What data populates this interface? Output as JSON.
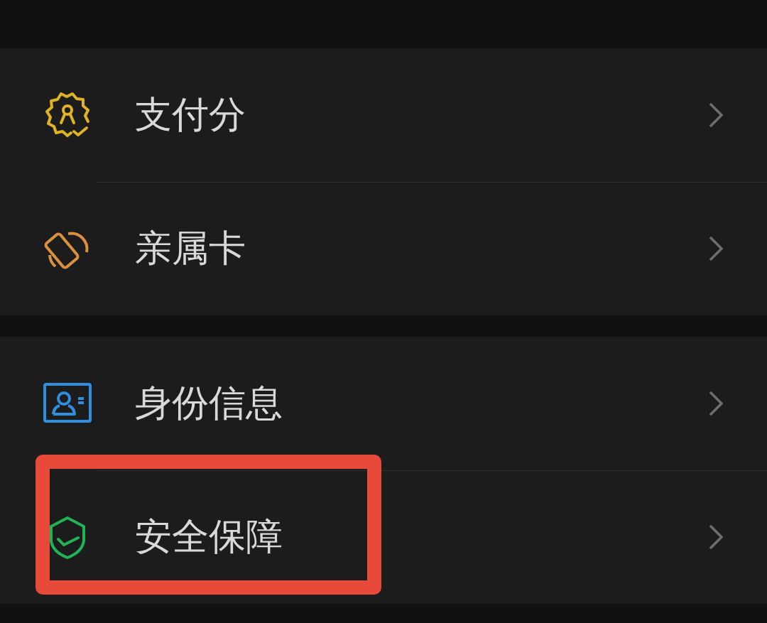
{
  "groups": [
    {
      "items": [
        {
          "label": "支付分",
          "color": "#e0b324",
          "highlighted": false
        },
        {
          "label": "亲属卡",
          "color": "#d9913f",
          "highlighted": false
        }
      ]
    },
    {
      "items": [
        {
          "label": "身份信息",
          "color": "#2f8ee0",
          "highlighted": false
        },
        {
          "label": "安全保障",
          "color": "#22b356",
          "highlighted": true
        }
      ]
    }
  ]
}
